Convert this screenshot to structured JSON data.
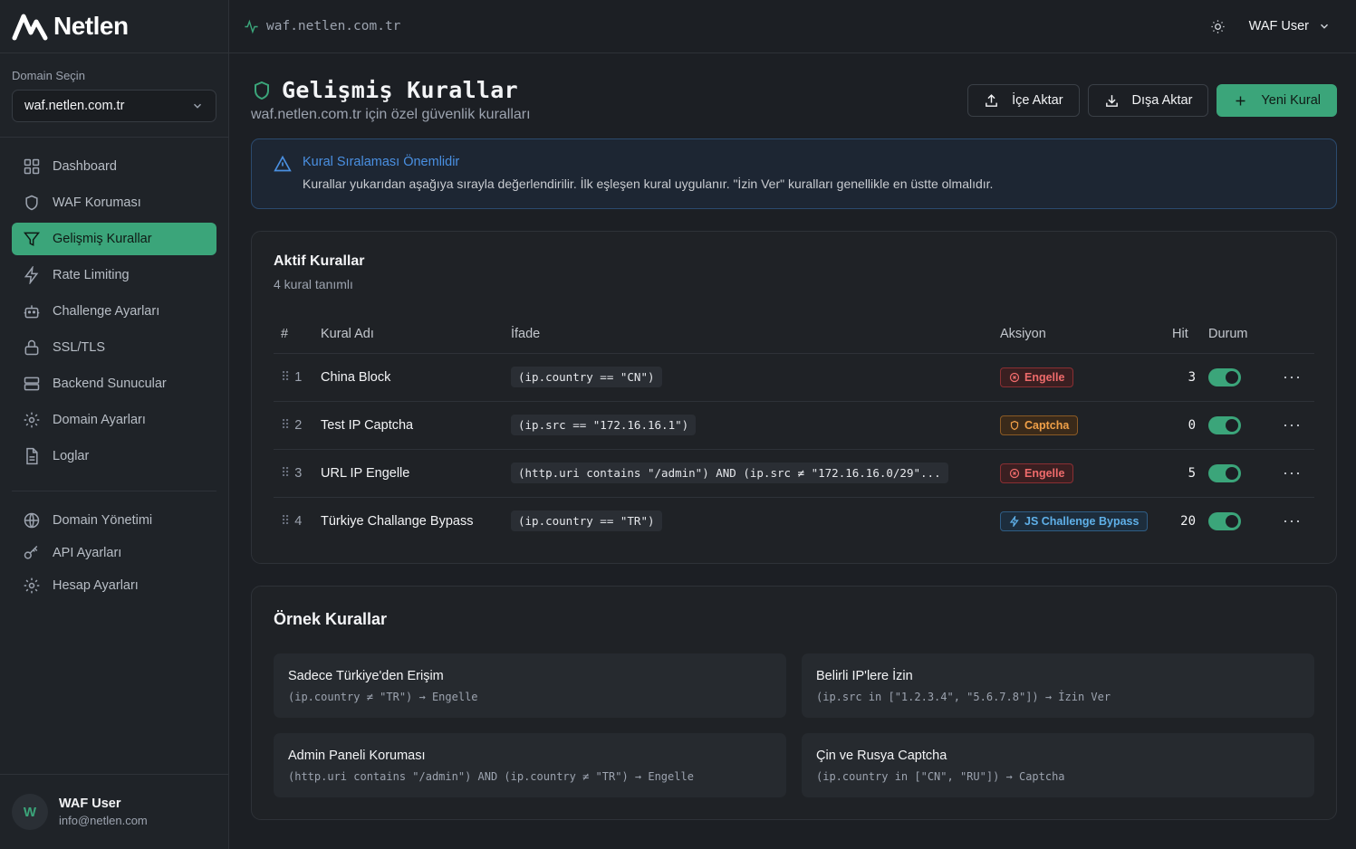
{
  "brand": {
    "name": "Netlen"
  },
  "sidebar": {
    "domain_label": "Domain Seçin",
    "domain_value": "waf.netlen.com.tr",
    "items": [
      {
        "label": "Dashboard",
        "icon": "dashboard-icon"
      },
      {
        "label": "WAF Koruması",
        "icon": "shield-icon"
      },
      {
        "label": "Gelişmiş Kurallar",
        "icon": "filter-icon",
        "active": true
      },
      {
        "label": "Rate Limiting",
        "icon": "lightning-icon"
      },
      {
        "label": "Challenge Ayarları",
        "icon": "robot-icon"
      },
      {
        "label": "SSL/TLS",
        "icon": "lock-icon"
      },
      {
        "label": "Backend Sunucular",
        "icon": "server-icon"
      },
      {
        "label": "Domain Ayarları",
        "icon": "gear-icon"
      },
      {
        "label": "Loglar",
        "icon": "document-icon"
      }
    ],
    "secondary_items": [
      {
        "label": "Domain Yönetimi",
        "icon": "globe-icon"
      },
      {
        "label": "API Ayarları",
        "icon": "key-icon"
      },
      {
        "label": "Hesap Ayarları",
        "icon": "gear-icon"
      }
    ],
    "user": {
      "initial": "W",
      "name": "WAF User",
      "email": "info@netlen.com"
    }
  },
  "topbar": {
    "url": "waf.netlen.com.tr",
    "user_label": "WAF User"
  },
  "page": {
    "title": "Gelişmiş Kurallar",
    "subtitle": "waf.netlen.com.tr için özel güvenlik kuralları",
    "import_label": "İçe Aktar",
    "export_label": "Dışa Aktar",
    "new_rule_label": "Yeni Kural"
  },
  "alert": {
    "title": "Kural Sıralaması Önemlidir",
    "text": "Kurallar yukarıdan aşağıya sırayla değerlendirilir. İlk eşleşen kural uygulanır. \"İzin Ver\" kuralları genellikle en üstte olmalıdır."
  },
  "rules_card": {
    "title": "Aktif Kurallar",
    "subtitle": "4 kural tanımlı",
    "columns": {
      "num": "#",
      "name": "Kural Adı",
      "expr": "İfade",
      "action": "Aksiyon",
      "hit": "Hit",
      "status": "Durum"
    },
    "rows": [
      {
        "num": "1",
        "name": "China Block",
        "expr": "(ip.country == \"CN\")",
        "action": "Engelle",
        "action_type": "block",
        "hit": "3",
        "enabled": true
      },
      {
        "num": "2",
        "name": "Test IP Captcha",
        "expr": "(ip.src == \"172.16.16.1\")",
        "action": "Captcha",
        "action_type": "captcha",
        "hit": "0",
        "enabled": true
      },
      {
        "num": "3",
        "name": "URL IP Engelle",
        "expr": "(http.uri contains \"/admin\") AND (ip.src ≠ \"172.16.16.0/29\"...",
        "action": "Engelle",
        "action_type": "block",
        "hit": "5",
        "enabled": true
      },
      {
        "num": "4",
        "name": "Türkiye Challange Bypass",
        "expr": "(ip.country == \"TR\")",
        "action": "JS Challenge Bypass",
        "action_type": "js",
        "hit": "20",
        "enabled": true
      }
    ]
  },
  "examples": {
    "title": "Örnek Kurallar",
    "items": [
      {
        "title": "Sadece Türkiye'den Erişim",
        "code": "(ip.country ≠ \"TR\") → Engelle"
      },
      {
        "title": "Belirli IP'lere İzin",
        "code": "(ip.src in [\"1.2.3.4\", \"5.6.7.8\"]) → İzin Ver"
      },
      {
        "title": "Admin Paneli Koruması",
        "code": "(http.uri contains \"/admin\") AND (ip.country ≠ \"TR\") → Engelle"
      },
      {
        "title": "Çin ve Rusya Captcha",
        "code": "(ip.country in [\"CN\", \"RU\"]) → Captcha"
      }
    ]
  },
  "colors": {
    "accent": "#3ba57a",
    "block": "#ef6b6b",
    "captcha": "#f0a048",
    "js": "#5fb0e8",
    "info": "#4a90e2"
  }
}
